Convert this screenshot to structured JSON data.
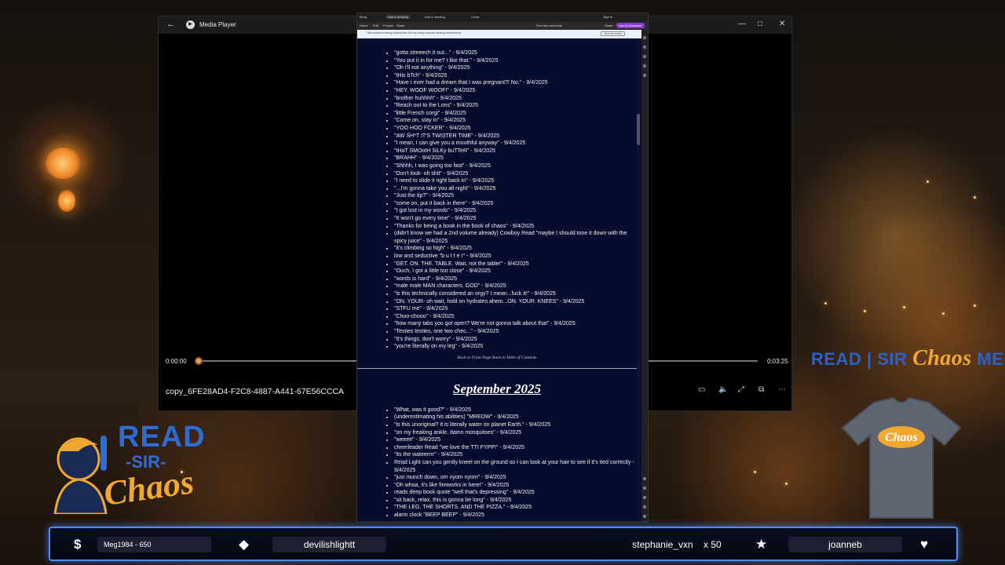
{
  "media_player": {
    "title": "Media Player",
    "current_time": "0:00:00",
    "total_time": "0:03:25",
    "progress": 0.0,
    "file_name": "copy_6FE28AD4-F2C8-4887-A441-67E56CCCA"
  },
  "browser": {
    "tabs": [
      "Bring",
      "Add a heading",
      "Add a heading",
      "Cover"
    ],
    "toolbar": [
      "Home",
      "Edit",
      "Format",
      "Share",
      "Find text and tools",
      "Sign in"
    ],
    "share_label": "Share",
    "ask_button": "Ask AI Assistant",
    "infobar_text": "This content is being shared from Sim by using a secure viewing environment",
    "infobar_button": "View summary",
    "list_aug": [
      "\"gotta streeech it out...\" - 9/4/2025",
      "\"You put it in for me? I like that.\" - 9/4/2025",
      "\"Oh I'll eat anything\" - 9/4/2025",
      "\"tHis bTch\" - 9/4/2025",
      "\"Have I ever had a dream that I was pregnant?! No.\" - 9/4/2025",
      "\"HEY. WOOF WOOF!\" - 9/4/2025",
      "\"brother huhhhh\" - 9/4/2025",
      "\"Reach out to the Lons\" - 9/4/2025",
      "\"little French corgi\" - 9/4/2025",
      "\"Come on, stay in\" - 9/4/2025",
      "\"YOO HOO FCKER\" - 9/4/2025",
      "\"AW SH*T IT'S TWISTER TIME\" - 9/4/2025",
      "\"I mean, I can give you a mouthful anyway\" - 9/4/2025",
      "\"tHaT SMOotH SiLKy buTTeR\" - 9/4/2025",
      "\"BRAHH\" - 9/4/2025",
      "\"Shhhh, I was going too fast\" - 9/4/2025",
      "\"Don't look- oh shit\" - 9/4/2025",
      "\"I need to slide it right back in\" - 9/4/2025",
      "\"...I'm gonna take you all night\" - 9/4/2025",
      "\"Just the tip?\" - 9/4/2025",
      "\"come on, put it back in there\" - 9/4/2025",
      "\"I got lost in my words\" - 9/4/2025",
      "\"It won't go every time\" - 9/4/2025",
      "\"Thanks for being a book in the book of chaos\" - 9/4/2025",
      "(didn't know we had a 2nd volume already) Cowboy Read \"maybe I should tone it down with the spicy juice\" - 9/4/2025",
      "\"it's climbing so high\" - 9/4/2025",
      "low and seductive \"b u t t e r\" - 9/4/2025",
      "\"GET. ON. THE. TABLE. Wait, not the table!\" - 9/4/2025",
      "\"Ouch, I got a little too close\" - 9/4/2025",
      "\"words is hard\" - 9/4/2025",
      "\"male male MAN characters. GOD\" - 9/4/2025",
      "\"is this technically considered an orgy? I mean...fuck it!\" - 9/4/2025",
      "\"ON. YOUR- oh wait, hold on hydrates ahem...ON. YOUR. KNEES\" - 9/4/2025",
      "\"STFU me\" - 9/4/2025",
      "\"Choo-chooo\" - 9/4/2025",
      "\"how many tabs you got open? We're not gonna talk about that\" - 9/4/2025",
      "\"Testies testies, one two chec...\" - 9/4/2025",
      "\"It's things, don't worry\" - 9/4/2025",
      "\"you're literally on my leg\" - 9/4/2025"
    ],
    "nav_links": "Back to Front Page    Back to Table of Contents",
    "section_heading": "September 2025",
    "list_sep": [
      "\"What, was it good?\" - 9/4/2025",
      "(underestimating his abilities) \"MREOW\" - 9/4/2025",
      "\"is this unoriginal? it is literally water on planet Earth.\" - 9/4/2025",
      "\"on my freaking ankle, damn mosquitoes\" - 9/4/2025",
      "\"weeee\" - 9/4/2025",
      "cheerleader Read \"we love the TTI FYPP!\" - 9/4/2025",
      "\"its the wateerrrr\" - 9/4/2025",
      "Read Light can you gently kneel on the ground so I can look at your hair to see if it's tied correctly - 9/4/2025",
      "\"just munch down, om nyom nyom\" - 9/4/2025",
      "\"Oh whoa, it's like fireworks in here!\" - 9/4/2025",
      "reads deep book quote \"well that's depressing\" - 9/4/2025",
      "\"sit back, relax, this is gonna be long\" - 9/4/2025",
      "\"THE LEG. THE SHORTS. AND THE PIZZA.\" - 9/4/2025",
      "alarm clock \"BEEP BEEP\" - 9/4/2025"
    ]
  },
  "overlay": {
    "merch_read": "READ",
    "merch_sep": "|",
    "merch_sir": "SIR",
    "merch_chaos": "Chaos",
    "merch_word": "MERCH",
    "shirt_text": "Chaos",
    "logo_read": "READ",
    "logo_sir": "-SIR-",
    "logo_chaos": "Chaos"
  },
  "bottom_bar": {
    "dollar_icon": "$",
    "top_donor": "Meg1984 - 650",
    "top_gifter": "devilishlightt",
    "sub_gifter": "stephanie_vxn",
    "sub_count": "x 50",
    "latest_follower": "joanneb",
    "accent_color": "#4f8cff"
  }
}
